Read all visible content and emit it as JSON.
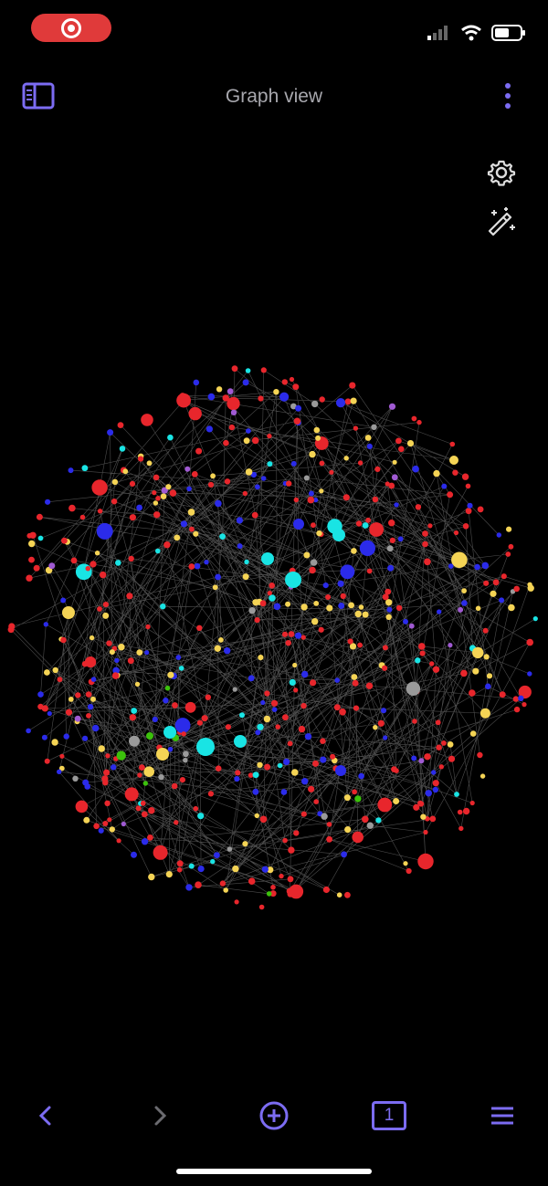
{
  "header": {
    "title": "Graph view",
    "icons": {
      "sidebar": "sidebar-toggle-icon",
      "more": "more-vertical-icon"
    }
  },
  "tools": {
    "settings": "gear-icon",
    "wand": "magic-wand-icon"
  },
  "graph": {
    "node_color_legend": {
      "red": "#e8262c",
      "yellow": "#f5d455",
      "blue": "#2b2bea",
      "cyan": "#19e4e4",
      "grey": "#9a9a9a",
      "purple": "#a05ad2",
      "green": "#3cc10c"
    },
    "edge_color": "#4c4c4c"
  },
  "bottom_bar": {
    "back": "chevron-left-icon",
    "forward": "chevron-right-icon",
    "new_note": "plus-circle-icon",
    "tab_count": "1",
    "menu": "menu-icon"
  },
  "accent": "#7c6cf2"
}
